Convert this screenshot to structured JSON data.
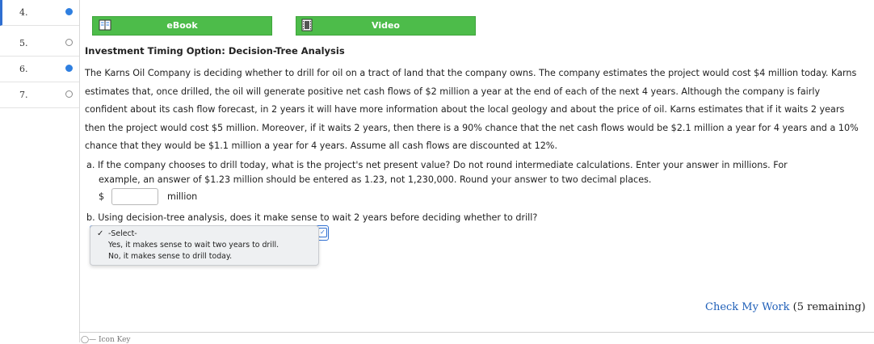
{
  "nav": {
    "items": [
      {
        "number": "4.",
        "status": "answered",
        "active": true
      },
      {
        "number": "5.",
        "status": "unanswered",
        "active": false
      },
      {
        "number": "6.",
        "status": "answered",
        "active": false
      },
      {
        "number": "7.",
        "status": "unanswered",
        "active": false
      }
    ]
  },
  "resources": {
    "ebook_label": "eBook",
    "ebook_icon": "book-icon",
    "video_label": "Video",
    "video_icon": "film-icon",
    "button_color": "#4dbc4a"
  },
  "question": {
    "title": "Investment Timing Option: Decision-Tree Analysis",
    "text": "The Karns Oil Company is deciding whether to drill for oil on a tract of land that the company owns. The company estimates the project would cost $4 million today. Karns estimates that, once drilled, the oil will generate positive net cash flows of $2 million a year at the end of each of the next 4 years. Although the company is fairly confident about its cash flow forecast, in 2 years it will have more information about the local geology and about the price of oil. Karns estimates that if it waits 2 years then the project would cost $5 million. Moreover, if it waits 2 years, then there is a 90% chance that the net cash flows would be $2.1 million a year for 4 years and a 10% chance that they would be $1.1 million a year for 4 years. Assume all cash flows are discounted at 12%.",
    "part_a_line1": "a. If the company chooses to drill today, what is the project's net present value? Do not round intermediate calculations. Enter your answer in millions. For",
    "part_a_line2": "example, an answer of $1.23 million should be entered as 1.23, not 1,230,000. Round your answer to two decimal places.",
    "currency": "$",
    "answer_value": "",
    "unit": "million",
    "part_b": "b. Using decision-tree analysis, does it make sense to wait 2 years before deciding whether to drill?"
  },
  "dropdown": {
    "selected": "-Select-",
    "options": [
      "-Select-",
      "Yes, it makes sense to wait two years to drill.",
      "No, it makes sense to drill today."
    ]
  },
  "footer": {
    "check_label": "Check My Work",
    "remaining": "(5 remaining)",
    "icon_key": "Icon Key"
  }
}
